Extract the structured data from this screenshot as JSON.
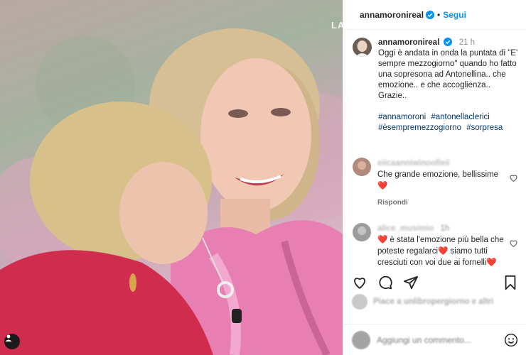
{
  "photo": {
    "overlay_text": "LA"
  },
  "header": {
    "username": "annamoronireal",
    "dot": "•",
    "follow_label": "Segui"
  },
  "caption": {
    "username": "annamoronireal",
    "time": "21 h",
    "text": "Oggi è andata in onda la puntata di \"E' sempre mezzogiorno\" quando ho fatto una sopresona ad Antonellina.. che emozione.. e che accoglienza.. Grazie..",
    "hashtags": [
      "#annamoroni",
      "#antonellaclerici",
      "#èsempremezzogiorno",
      "#sorpresa"
    ]
  },
  "comments": [
    {
      "username": "eiicaanniwinoolleii",
      "time": "",
      "text": "Che grande emozione, bellissime ❤️",
      "reply_label": "Rispondi"
    },
    {
      "username": "alice_musimio",
      "time": "1h",
      "text": "❤️ è stata l'emozione più bella che poteste regalarci❤️ siamo tutti cresciuti con voi due ai fornelli❤️",
      "reply_label": ""
    }
  ],
  "likes": {
    "text": "Piace a unlibropergiorno e altri"
  },
  "add_comment": {
    "placeholder": "Aggiungi un commento..."
  },
  "colors": {
    "accent": "#0095f6",
    "heart": "#ed4956",
    "hashtag": "#00376b"
  },
  "icons": [
    "heart-icon",
    "comment-icon",
    "share-icon",
    "bookmark-icon",
    "emoji-icon",
    "verified-icon",
    "user-tag-icon"
  ]
}
